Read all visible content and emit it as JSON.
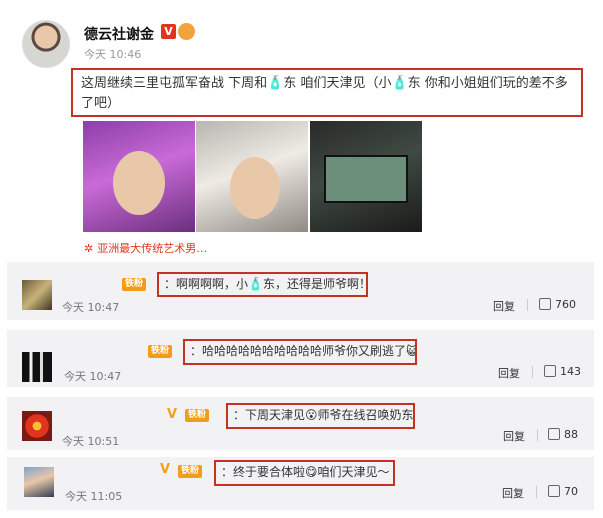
{
  "post": {
    "username": "德云社谢金",
    "verified_badge": "V",
    "time": "今天 10:46",
    "text": "这周继续三里屯孤军奋战 下周和🧴东 咱们天津见（小🧴东 你和小姐姐们玩的差不多了吧）",
    "images": [
      {
        "icon": "portrait-neon-visor-photo"
      },
      {
        "icon": "portrait-baseball-cap-photo"
      },
      {
        "icon": "monitor-screen-photo"
      }
    ],
    "tagline": "亚洲最大传统艺术男…",
    "tagline_icon": "flower-icon",
    "colors": {
      "highlight_border": "#c23321",
      "verified_red": "#e0341e",
      "fan_badge": "#f29c1a"
    }
  },
  "comments": [
    {
      "fan_label": "铁粉",
      "vip": "",
      "text": "：啊啊啊啊，小🧴东，还得是师爷啊！！",
      "time": "今天 10:47",
      "reply": "回复",
      "likes": "760"
    },
    {
      "fan_label": "铁粉",
      "vip": "",
      "text": "：哈哈哈哈哈哈哈哈哈哈师爷你又刷逃了😺😺",
      "time": "今天 10:47",
      "reply": "回复",
      "likes": "143"
    },
    {
      "fan_label": "铁粉",
      "vip": "V",
      "text": "：下周天津见😮师爷在线召唤奶东🧴",
      "time": "今天 10:51",
      "reply": "回复",
      "likes": "88"
    },
    {
      "fan_label": "铁粉",
      "vip": "V",
      "text": "：终于要合体啦😋咱们天津见～",
      "time": "今天 11:05",
      "reply": "回复",
      "likes": "70"
    }
  ]
}
